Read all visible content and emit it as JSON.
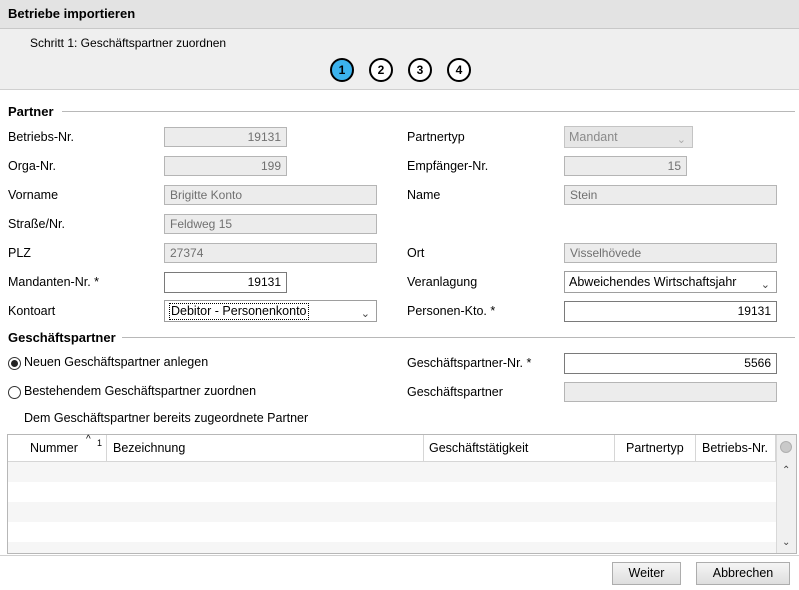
{
  "window": {
    "title": "Betriebe importieren"
  },
  "wizard": {
    "step_text": "Schritt 1: Geschäftspartner zuordnen",
    "steps": [
      "1",
      "2",
      "3",
      "4"
    ],
    "active_step": 1,
    "active_color": "#3bb3ee"
  },
  "partner": {
    "section": "Partner",
    "betriebs_nr": {
      "label": "Betriebs-Nr.",
      "value": "19131"
    },
    "orga_nr": {
      "label": "Orga-Nr.",
      "value": "199"
    },
    "vorname": {
      "label": "Vorname",
      "value": "Brigitte Konto"
    },
    "strasse": {
      "label": "Straße/Nr.",
      "value": "Feldweg 15"
    },
    "plz": {
      "label": "PLZ",
      "value": "27374"
    },
    "mandanten_nr": {
      "label": "Mandanten-Nr. *",
      "value": "19131"
    },
    "kontoart": {
      "label": "Kontoart",
      "value": "Debitor - Personenkonto"
    },
    "partnertyp": {
      "label": "Partnertyp",
      "value": "Mandant"
    },
    "empfaenger_nr": {
      "label": "Empfänger-Nr.",
      "value": "15"
    },
    "name": {
      "label": "Name",
      "value": "Stein"
    },
    "ort": {
      "label": "Ort",
      "value": "Visselhövede"
    },
    "veranlagung": {
      "label": "Veranlagung",
      "value": "Abweichendes Wirtschaftsjahr"
    },
    "personen_kto": {
      "label": "Personen-Kto. *",
      "value": "19131"
    }
  },
  "geschaeftspartner": {
    "section": "Geschäftspartner",
    "radio_new": "Neuen Geschäftspartner anlegen",
    "radio_existing": "Bestehendem Geschäftspartner zuordnen",
    "gp_nr": {
      "label": "Geschäftspartner-Nr. *",
      "value": "5566"
    },
    "gp": {
      "label": "Geschäftspartner",
      "value": ""
    },
    "assigned_label": "Dem Geschäftspartner bereits zugeordnete Partner"
  },
  "table": {
    "columns": [
      "Nummer",
      "Bezeichnung",
      "Geschäftstätigkeit",
      "Partnertyp",
      "Betriebs-Nr."
    ],
    "sort_index": "1",
    "rows": []
  },
  "buttons": {
    "next": "Weiter",
    "cancel": "Abbrechen"
  }
}
